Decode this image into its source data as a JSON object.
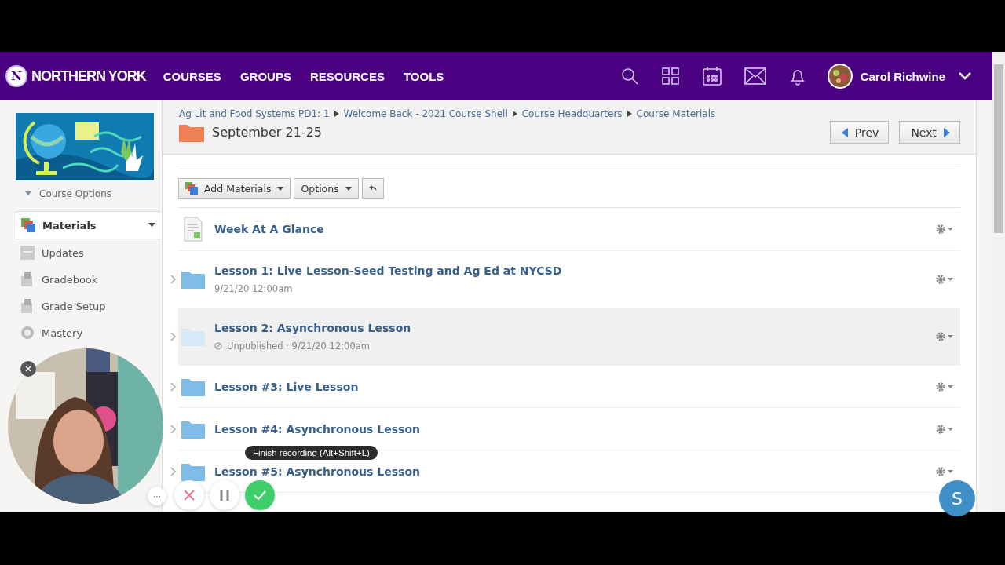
{
  "brand": {
    "name": "NORTHERN YORK",
    "logo_letter": "N"
  },
  "nav": [
    {
      "label": "COURSES"
    },
    {
      "label": "GROUPS"
    },
    {
      "label": "RESOURCES"
    },
    {
      "label": "TOOLS"
    }
  ],
  "user": {
    "name": "Carol Richwine"
  },
  "sidebar": {
    "course_options": "Course Options",
    "items": [
      {
        "label": "Materials",
        "selected": true
      },
      {
        "label": "Updates",
        "selected": false
      },
      {
        "label": "Gradebook",
        "selected": false
      },
      {
        "label": "Grade Setup",
        "selected": false
      },
      {
        "label": "Mastery",
        "selected": false
      }
    ]
  },
  "breadcrumb": [
    "Ag Lit and Food Systems PD1: 1",
    "Welcome Back - 2021 Course Shell",
    "Course Headquarters",
    "Course Materials"
  ],
  "page_title": "September 21-25",
  "pager": {
    "prev": "Prev",
    "next": "Next"
  },
  "toolbar": {
    "add": "Add Materials",
    "options": "Options"
  },
  "materials": [
    {
      "kind": "document",
      "title": "Week At A Glance",
      "published": true,
      "highlighted": false
    },
    {
      "kind": "folder",
      "title": "Lesson 1: Live Lesson-Seed Testing and Ag Ed at NYCSD",
      "meta": "9/21/20 12:00am",
      "published": true,
      "highlighted": false
    },
    {
      "kind": "folder",
      "title": "Lesson 2: Asynchronous Lesson",
      "meta": "Unpublished · 9/21/20 12:00am",
      "published": false,
      "highlighted": true
    },
    {
      "kind": "folder",
      "title": "Lesson #3: Live Lesson",
      "published": true,
      "highlighted": false
    },
    {
      "kind": "folder",
      "title": "Lesson #4: Asynchronous Lesson",
      "published": true,
      "highlighted": false
    },
    {
      "kind": "folder",
      "title": "Lesson #5: Asynchronous Lesson",
      "published": true,
      "highlighted": false
    }
  ],
  "recorder": {
    "tooltip": "Finish recording (Alt+Shift+L)",
    "more": "···"
  },
  "help_button": {
    "letter": "S"
  }
}
